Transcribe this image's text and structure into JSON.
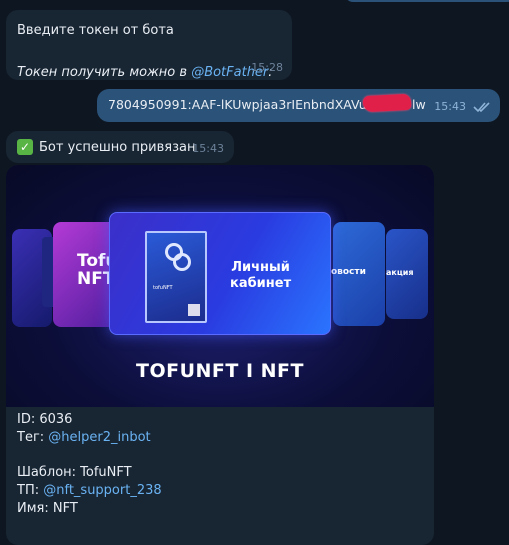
{
  "messages": {
    "m1": {
      "line1": "Введите токен от бота",
      "line2_prefix": "Токен получить можно в ",
      "line2_link": "@BotFather",
      "line2_suffix": ":",
      "time": "15:28"
    },
    "m2": {
      "token_visible_start": "7804950991:AAF-lKUwpjaa3rIEnbndXAVuu5",
      "token_visible_end": "lw",
      "time": "15:43",
      "status_icon": "double-check-icon"
    },
    "m3": {
      "text": "Бот успешно привязан",
      "emoji": "white-heavy-check-mark",
      "time": "15:43"
    },
    "m4": {
      "banner": {
        "title": "TOFUNFT I NFT",
        "card_left": "Tofu NFT",
        "card_main": "Личный кабинет",
        "card_main_mini": "tofuNFT",
        "card_right": "овости",
        "card_far_right": "акция"
      },
      "id_label": "ID: ",
      "id_value": "6036",
      "tag_label": "Тег: ",
      "tag_value": "@helper2_inbot",
      "template_label": "Шаблон: ",
      "template_value": "TofuNFT",
      "support_label": "ТП: ",
      "support_value": "@nft_support_238",
      "name_label": "Имя: ",
      "name_value": "NFT"
    }
  },
  "colors": {
    "background": "#0e1621",
    "incoming": "#182533",
    "outgoing": "#2b5278",
    "link": "#6ab3f3",
    "redaction": "#e1204a"
  }
}
